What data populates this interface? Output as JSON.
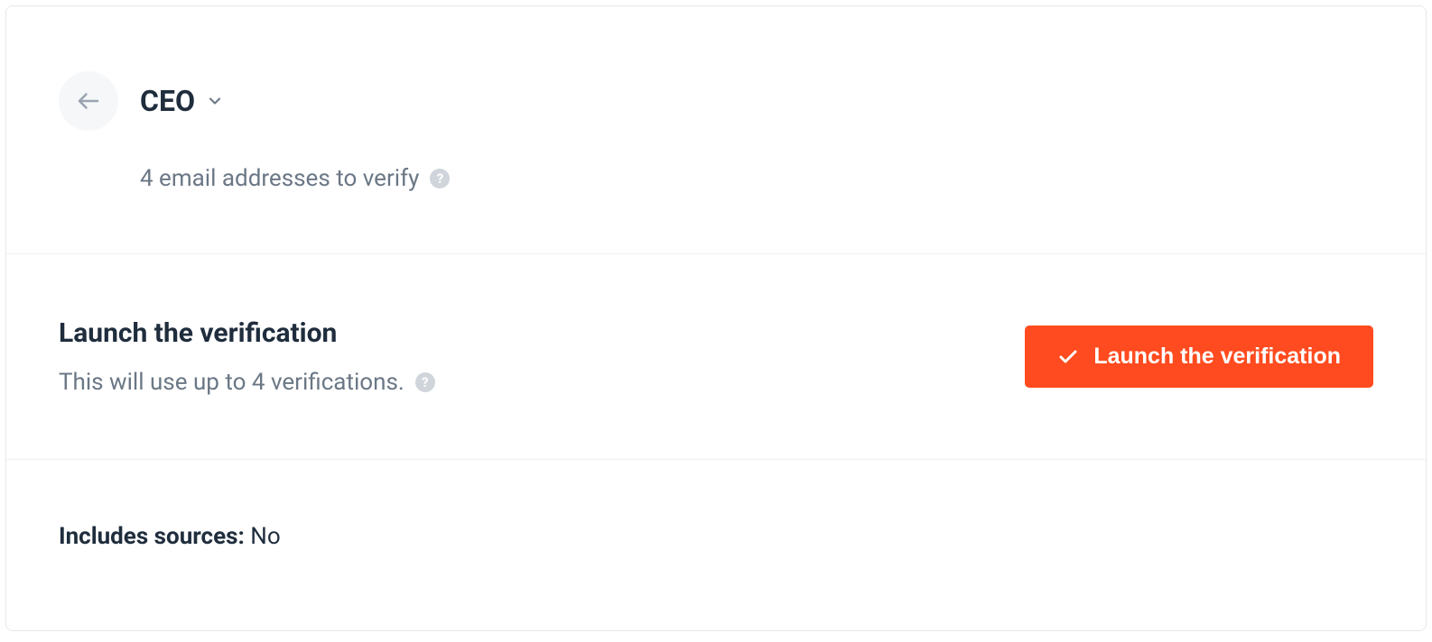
{
  "header": {
    "title": "CEO",
    "subtitle": "4 email addresses to verify"
  },
  "launch": {
    "title": "Launch the verification",
    "description": "This will use up to 4 verifications.",
    "button_label": "Launch the verification"
  },
  "sources": {
    "label": "Includes sources:",
    "value": "No"
  }
}
